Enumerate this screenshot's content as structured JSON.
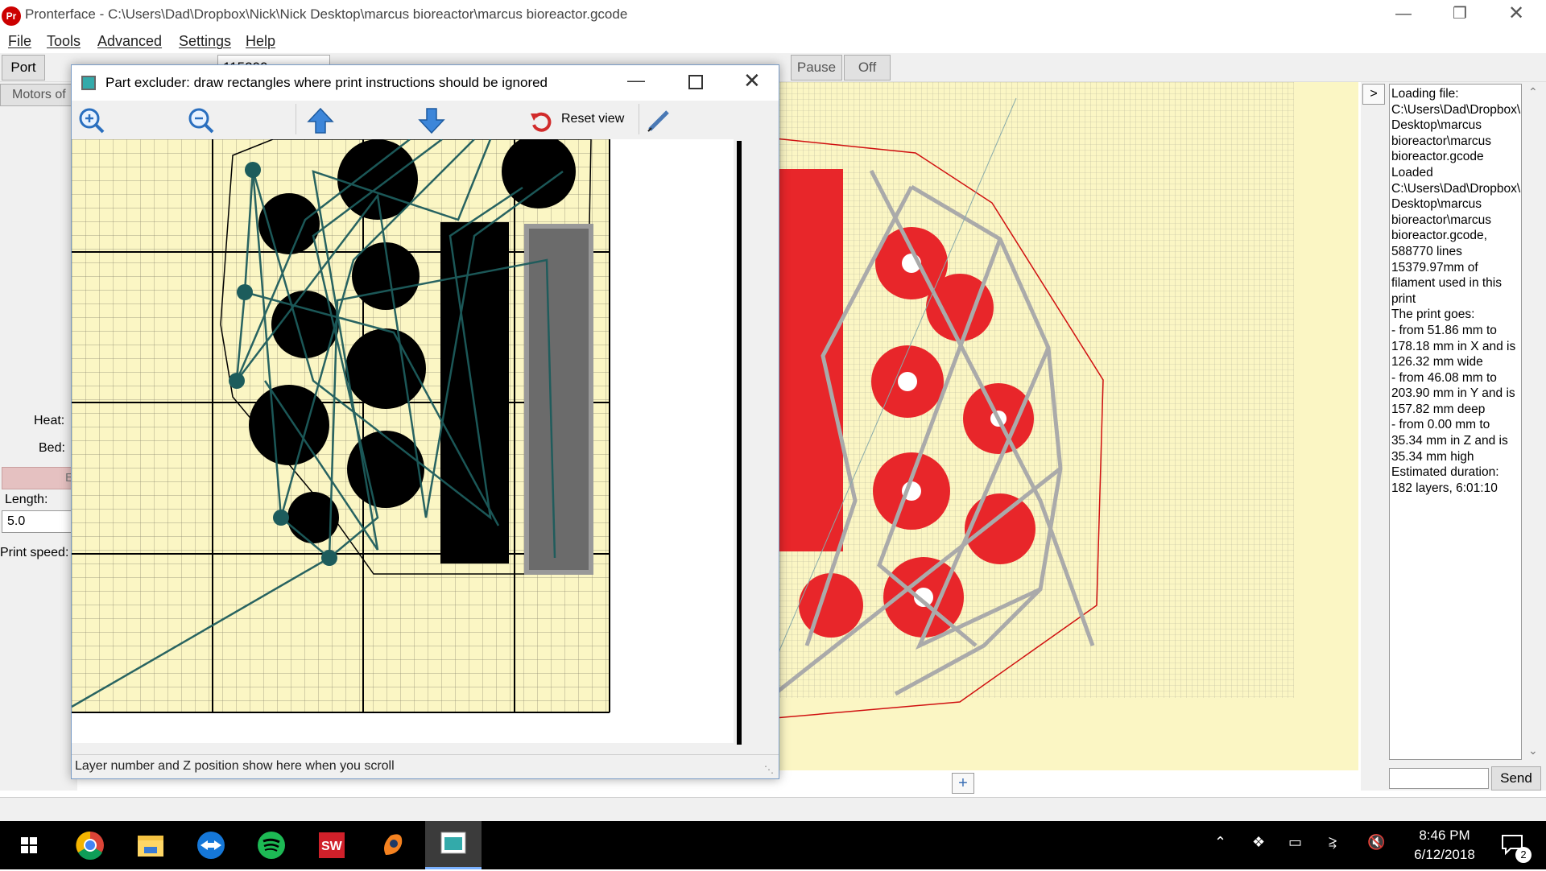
{
  "window": {
    "title": "Pronterface - C:\\Users\\Dad\\Dropbox\\Nick\\Nick Desktop\\marcus bioreactor\\marcus bioreactor.gcode",
    "app_icon_label": "Pr"
  },
  "menu": [
    "File",
    "Tools",
    "Advanced",
    "Settings",
    "Help"
  ],
  "toolbar": {
    "port_label": "Port",
    "baud_value": "115200",
    "pause_label": "Pause",
    "off_label": "Off"
  },
  "left_panel": {
    "motors_off": "Motors of",
    "heat_label": "Heat:",
    "bed_label": "Bed:",
    "extrude_label": "E",
    "length_label": "Length:",
    "length_value": "5.0",
    "print_speed_label": "Print speed:"
  },
  "dialog": {
    "title": "Part excluder: draw rectangles where print instructions should be ignored",
    "reset_view_label": "Reset view",
    "status_text": "Layer number and Z position show here when you scroll",
    "colors": {
      "toolpath": "#1d5c5c",
      "part": "#000000",
      "bed": "#fbf6c4"
    }
  },
  "console": {
    "toggle_label": ">",
    "send_label": "Send",
    "input_value": "",
    "log": "Loading file: C:\\Users\\Dad\\Dropbox\\Nick\\Nick Desktop\\marcus bioreactor\\marcus bioreactor.gcode\nLoaded C:\\Users\\Dad\\Dropbox\\Nick\\Nick Desktop\\marcus bioreactor\\marcus bioreactor.gcode, 588770 lines\n15379.97mm of filament used in this print\nThe print goes:\n- from 51.86 mm to 178.18 mm in X and is 126.32 mm wide\n- from 46.08 mm to 203.90 mm in Y and is 157.82 mm deep\n- from 0.00 mm to 35.34 mm in Z and is 35.34 mm high\nEstimated duration: 182 layers, 6:01:10"
  },
  "viewer": {
    "add_label": "+",
    "colors": {
      "part": "#e8262a",
      "travel": "#aaaaaa",
      "bed": "#fbf6c4"
    }
  },
  "taskbar": {
    "time": "8:46 PM",
    "date": "6/12/2018",
    "notification_count": "2",
    "apps": [
      "windows-start",
      "chrome",
      "file-explorer",
      "teamviewer",
      "spotify",
      "solidworks",
      "blender",
      "pronterface"
    ]
  }
}
